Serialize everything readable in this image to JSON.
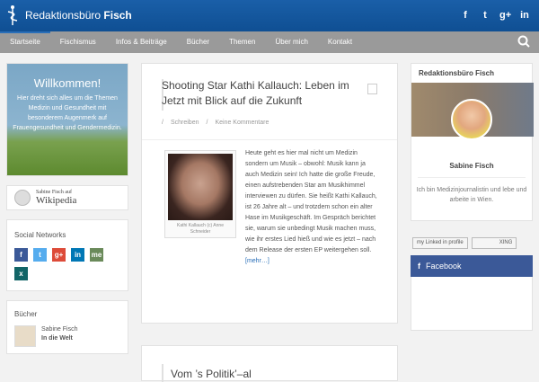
{
  "header": {
    "brand_regular": "Redaktionsbüro",
    "brand_bold": "Fisch",
    "social": [
      "f",
      "t",
      "g+",
      "in"
    ]
  },
  "nav": {
    "items": [
      "Startseite",
      "Fischismus",
      "Infos & Beiträge",
      "Bücher",
      "Themen",
      "Über mich",
      "Kontakt"
    ]
  },
  "left": {
    "welcome_title": "Willkommen!",
    "welcome_text": "Hier dreht sich alles um die Themen Medizin und Gesundheit mit besonderem Augenmerk auf Frauengesundheit und Gendermedizin.",
    "wiki_small": "Sabine Fisch auf",
    "wiki_big": "Wikipedia",
    "social_title": "Social Networks",
    "social_icons": [
      "f",
      "t",
      "g+",
      "in",
      "me",
      "x"
    ],
    "buecher_title": "Bücher",
    "book_author": "Sabine Fisch",
    "book_title": "In die Welt"
  },
  "post": {
    "title": "Shooting Star Kathi Kallauch: Leben im Jetzt mit Blick auf die Zukunft",
    "category": "Schreiben",
    "comments": "Keine Kommentare",
    "photo_caption": "Kathi Kallauch (c) Anne Schneider",
    "text": "Heute geht es hier mal nicht um Medizin sondern um Musik – obwohl: Musik kann ja auch Medizin sein! Ich hatte die große Freude, einen aufstrebenden Star am Musikhimmel interviewen zu dürfen. Sie heißt Kathi Kallauch, ist 26 Jahre alt – und trotzdem schon ein alter Hase im Musikgeschäft. Im Gespräch berichtet sie, warum sie unbedingt Musik machen muss, wie ihr erstes Lied hieß und wie es jetzt – nach dem Release der ersten EP weitergehen soll.",
    "more": "[mehr…]"
  },
  "post2": {
    "title": "Vom ’s Politik’–al"
  },
  "right": {
    "title": "Redaktionsbüro Fisch",
    "name": "Sabine Fisch",
    "desc": "Ich bin Medizinjournalistin und lebe und arbeite in Wien.",
    "badge_linkedin": "my Linked in profile",
    "badge_xing": "XING",
    "facebook": "Facebook"
  },
  "colors": {
    "header": "#1a5fa8",
    "nav": "#9a9a9a",
    "facebook": "#3b5998"
  }
}
